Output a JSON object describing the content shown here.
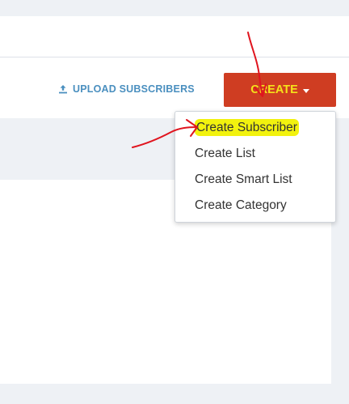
{
  "toolbar": {
    "upload_label": "UPLOAD SUBSCRIBERS",
    "upload_icon": "upload-icon",
    "create_label": "CREATE",
    "create_caret_icon": "caret-down-icon"
  },
  "create_menu": {
    "items": [
      {
        "label": "Create Subscriber",
        "highlighted": true
      },
      {
        "label": "Create List"
      },
      {
        "label": "Create Smart List"
      },
      {
        "label": "Create Category"
      }
    ]
  },
  "colors": {
    "create_button_bg": "#cf3d22",
    "create_button_text": "#f5e11a",
    "upload_link": "#4a8fbf",
    "highlight": "#f2f20e",
    "annotation_arrow": "#e0141e"
  }
}
